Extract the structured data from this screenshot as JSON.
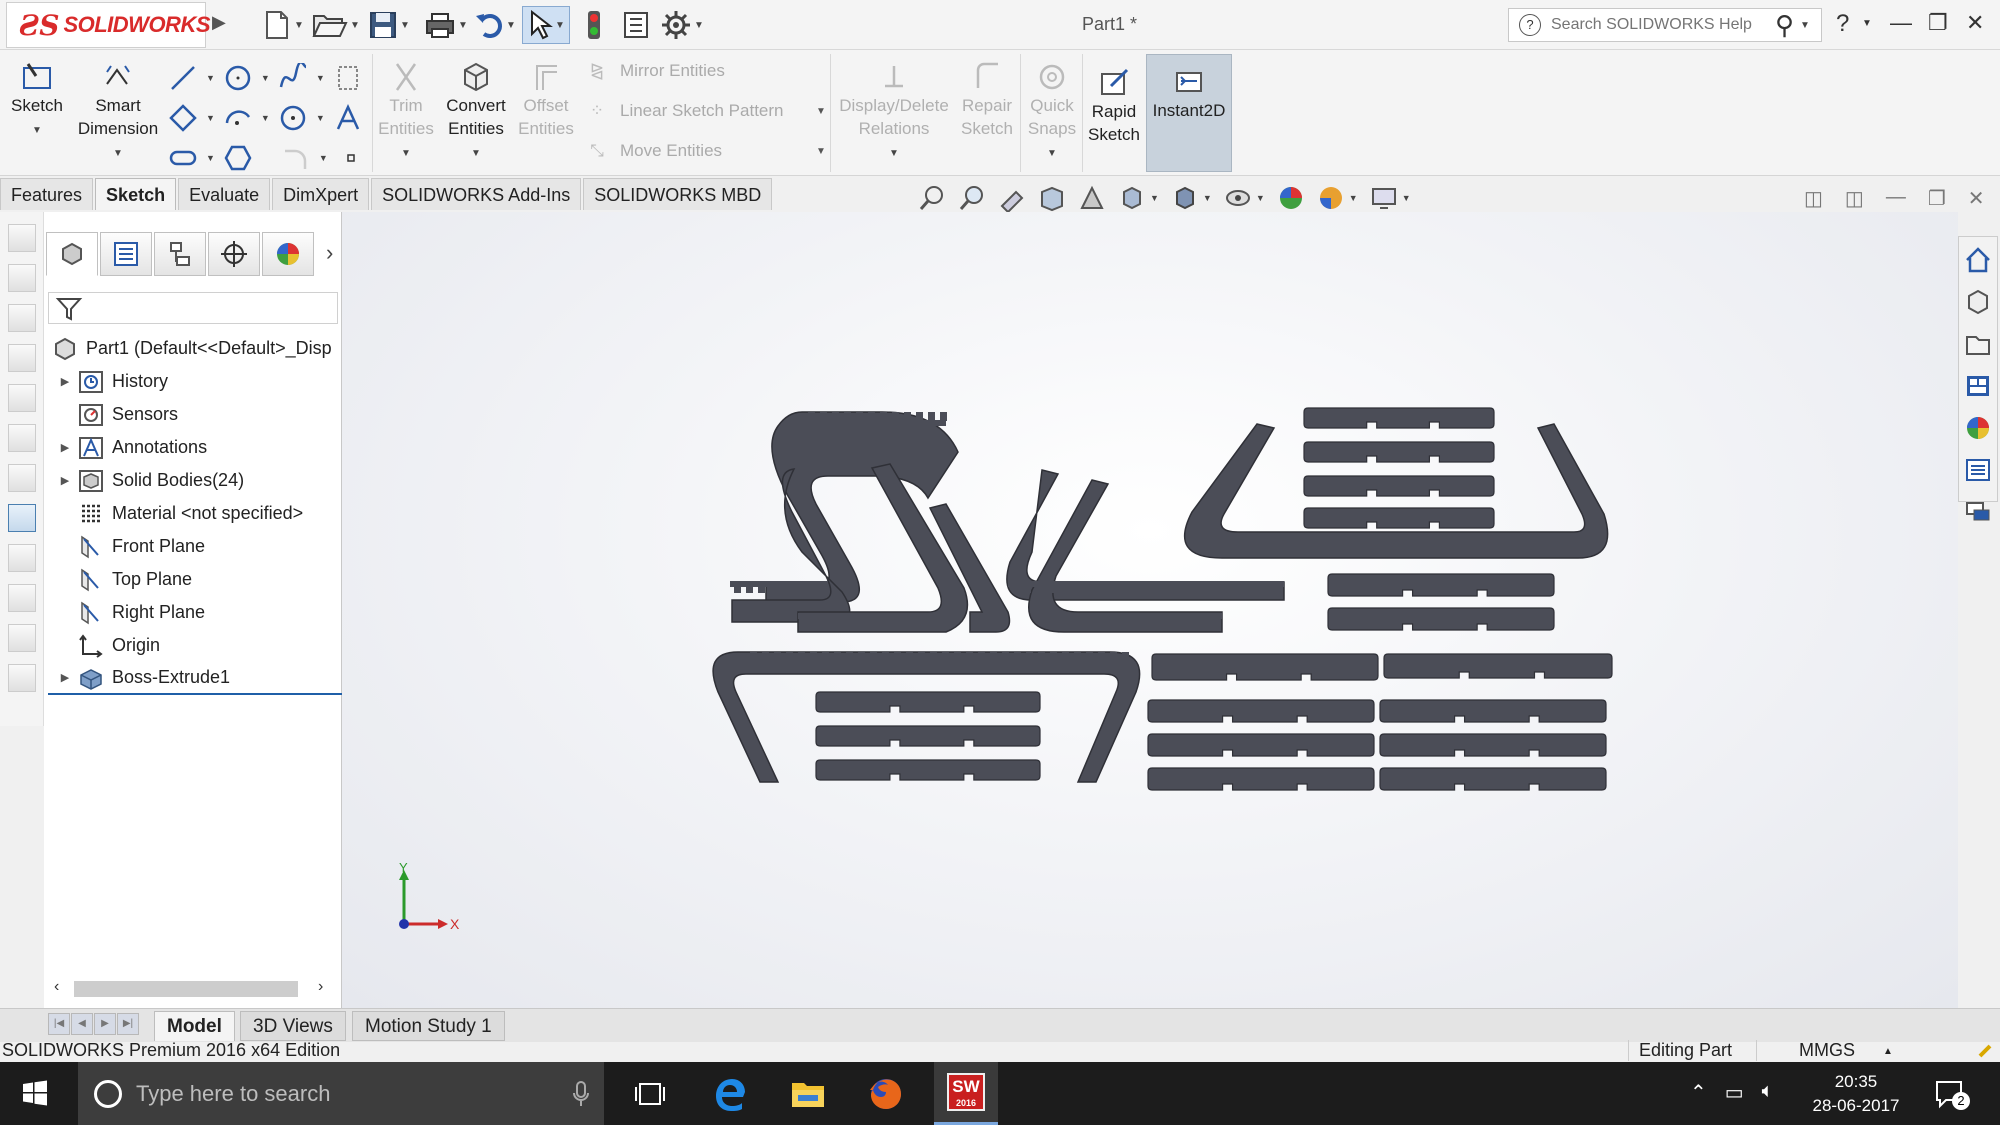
{
  "app": {
    "brand": "SOLIDWORKS",
    "doc_title": "Part1 *",
    "help_search_placeholder": "Search SOLIDWORKS Help"
  },
  "toolbar": {
    "sketch": "Sketch",
    "smart_dimension": [
      "Smart",
      "Dimension"
    ],
    "trim_entities": [
      "Trim",
      "Entities"
    ],
    "convert_entities": [
      "Convert",
      "Entities"
    ],
    "offset_entities": [
      "Offset",
      "Entities"
    ],
    "mirror_entities": "Mirror Entities",
    "linear_sketch_pattern": "Linear Sketch Pattern",
    "move_entities": "Move Entities",
    "display_delete_relations": [
      "Display/Delete",
      "Relations"
    ],
    "repair_sketch": [
      "Repair",
      "Sketch"
    ],
    "quick_snaps": [
      "Quick",
      "Snaps"
    ],
    "rapid_sketch": [
      "Rapid",
      "Sketch"
    ],
    "instant2d": "Instant2D"
  },
  "tabs": [
    "Features",
    "Sketch",
    "Evaluate",
    "DimXpert",
    "SOLIDWORKS Add-Ins",
    "SOLIDWORKS MBD"
  ],
  "active_tab": "Sketch",
  "tree": {
    "root": "Part1  (Default<<Default>_Disp",
    "items": [
      {
        "label": "History",
        "expandable": true,
        "icon": "history-icon"
      },
      {
        "label": "Sensors",
        "expandable": false,
        "icon": "sensors-icon"
      },
      {
        "label": "Annotations",
        "expandable": true,
        "icon": "annotations-icon"
      },
      {
        "label": "Solid Bodies(24)",
        "expandable": true,
        "icon": "solid-bodies-icon"
      },
      {
        "label": "Material <not specified>",
        "expandable": false,
        "icon": "material-icon"
      },
      {
        "label": "Front Plane",
        "expandable": false,
        "icon": "plane-icon"
      },
      {
        "label": "Top Plane",
        "expandable": false,
        "icon": "plane-icon"
      },
      {
        "label": "Right Plane",
        "expandable": false,
        "icon": "plane-icon"
      },
      {
        "label": "Origin",
        "expandable": false,
        "icon": "origin-icon"
      },
      {
        "label": "Boss-Extrude1",
        "expandable": true,
        "icon": "extrude-icon"
      }
    ]
  },
  "triad": {
    "x": "X",
    "y": "Y"
  },
  "model_tabs": [
    "Model",
    "3D Views",
    "Motion Study 1"
  ],
  "active_model_tab": "Model",
  "status": {
    "edition": "SOLIDWORKS Premium 2016 x64 Edition",
    "mode": "Editing Part",
    "units": "MMGS"
  },
  "taskbar": {
    "search_placeholder": "Type here to search",
    "time": "20:35",
    "date": "28-06-2017",
    "notification_count": "2",
    "sw_badge": "SW",
    "sw_year": "2016"
  },
  "colors": {
    "brand_red": "#d92b2b",
    "model_gray": "#4b4d57",
    "selection_blue": "#1f5fa8"
  }
}
